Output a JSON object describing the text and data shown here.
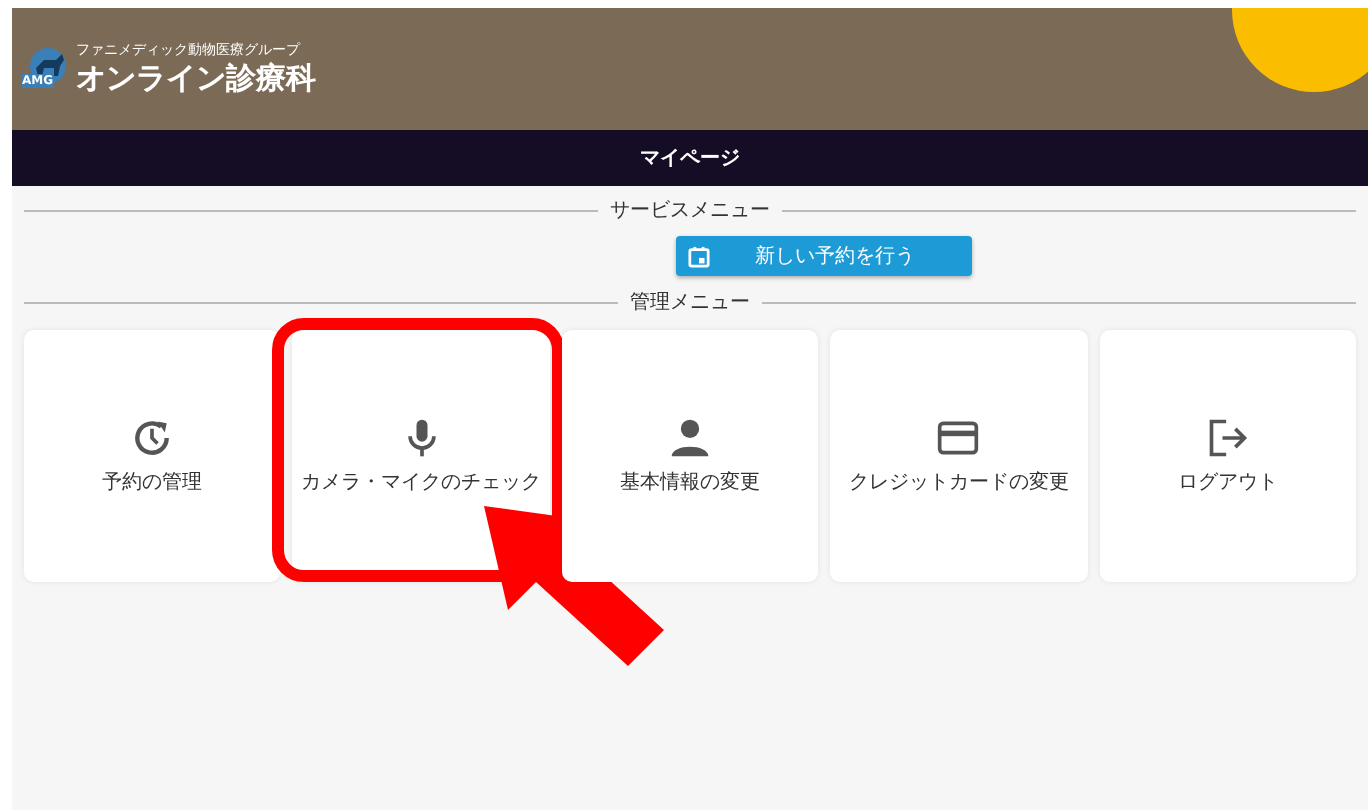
{
  "header": {
    "group_name": "ファニメディック動物医療グループ",
    "title": "オンライン診療科",
    "logo_text": "AMG"
  },
  "nav": {
    "title": "マイページ"
  },
  "service_menu": {
    "title": "サービスメニュー",
    "button": "新しい予約を行う"
  },
  "management_menu": {
    "title": "管理メニュー",
    "cards": [
      {
        "kind": "history",
        "label": "予約の管理",
        "highlighted": false
      },
      {
        "kind": "mic",
        "label": "カメラ・マイクのチェック",
        "highlighted": true
      },
      {
        "kind": "person",
        "label": "基本情報の変更",
        "highlighted": false
      },
      {
        "kind": "card",
        "label": "クレジットカードの変更",
        "highlighted": false
      },
      {
        "kind": "logout",
        "label": "ログアウト",
        "highlighted": false
      }
    ]
  }
}
